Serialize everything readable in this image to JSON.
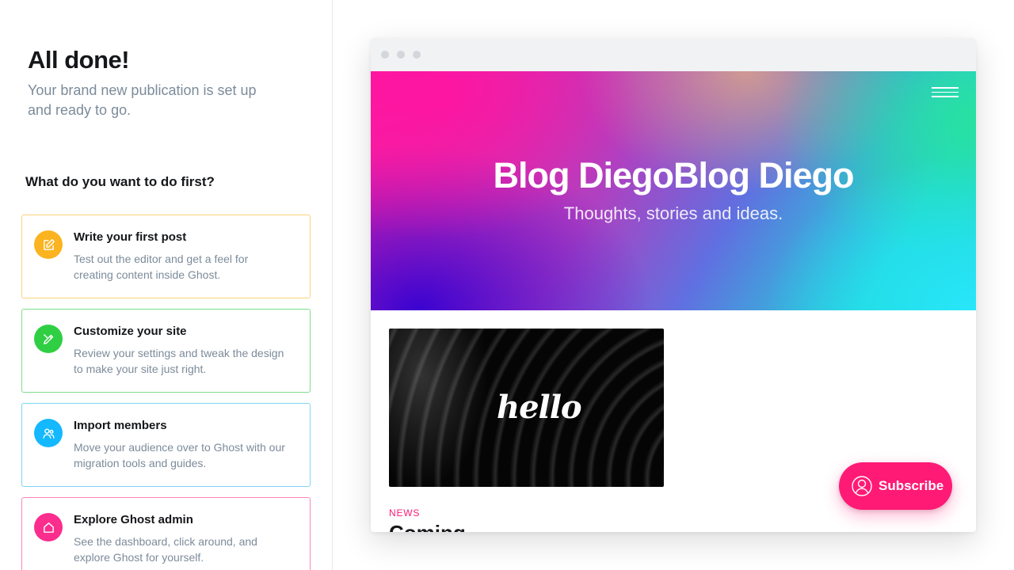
{
  "onboarding": {
    "title": "All done!",
    "subtitle": "Your brand new publication is set up and ready to go.",
    "question": "What do you want to do first?",
    "cards": [
      {
        "title": "Write your first post",
        "description": "Test out the editor and get a feel for creating content inside Ghost.",
        "icon": "edit-icon",
        "color": "#fbb31f"
      },
      {
        "title": "Customize your site",
        "description": "Review your settings and tweak the design to make your site just right.",
        "icon": "brush-icon",
        "color": "#30cf43"
      },
      {
        "title": "Import members",
        "description": "Move your audience over to Ghost with our migration tools and guides.",
        "icon": "members-icon",
        "color": "#14b8ff"
      },
      {
        "title": "Explore Ghost admin",
        "description": "See the dashboard, click around, and explore Ghost for yourself.",
        "icon": "home-icon",
        "color": "#fb2d8d"
      }
    ]
  },
  "preview": {
    "site_title": "Blog DiegoBlog Diego",
    "site_description": "Thoughts, stories and ideas.",
    "menu_icon": "hamburger-icon",
    "post_image_text": "hello",
    "post_tag": "NEWS",
    "post_title_partial": "Coming",
    "subscribe_label": "Subscribe",
    "accent_color": "#ff1a75"
  }
}
